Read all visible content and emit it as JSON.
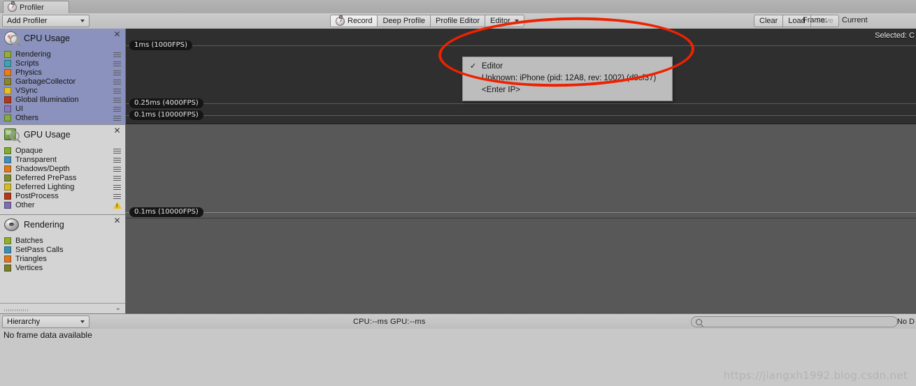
{
  "window": {
    "tab_label": "Profiler",
    "tab_icon": "stopwatch-icon"
  },
  "toolbar": {
    "add_profiler_label": "Add Profiler",
    "record_label": "Record",
    "deep_profile_label": "Deep Profile",
    "profile_editor_label": "Profile Editor",
    "target_label": "Editor",
    "clear_label": "Clear",
    "load_label": "Load",
    "save_label": "Save",
    "frame_label": "Frame:",
    "frame_value": "Current"
  },
  "target_menu": {
    "items": [
      {
        "label": "Editor",
        "checked": true
      },
      {
        "label": "Unknown: iPhone (pid: 12A8, rev: 1002) (d8cf37)",
        "checked": false
      },
      {
        "label": "<Enter IP>",
        "checked": false
      }
    ]
  },
  "modules": [
    {
      "title": "CPU Usage",
      "icon": "cpu-usage-icon",
      "selected": true,
      "close_icon": "close-icon",
      "legend": [
        {
          "label": "Rendering",
          "color": "#93ae30"
        },
        {
          "label": "Scripts",
          "color": "#3ba5b5"
        },
        {
          "label": "Physics",
          "color": "#e87e1a"
        },
        {
          "label": "GarbageCollector",
          "color": "#8b8728"
        },
        {
          "label": "VSync",
          "color": "#e3c223"
        },
        {
          "label": "Global Illumination",
          "color": "#b8361c"
        },
        {
          "label": "UI",
          "color": "#8a79b8"
        },
        {
          "label": "Others",
          "color": "#86ac3a"
        }
      ]
    },
    {
      "title": "GPU Usage",
      "icon": "gpu-usage-icon",
      "selected": false,
      "close_icon": "close-icon",
      "legend": [
        {
          "label": "Opaque",
          "color": "#7fad2e"
        },
        {
          "label": "Transparent",
          "color": "#3f8fc0"
        },
        {
          "label": "Shadows/Depth",
          "color": "#e07a1c"
        },
        {
          "label": "Deferred PrePass",
          "color": "#7f8c2c"
        },
        {
          "label": "Deferred Lighting",
          "color": "#d6bb26"
        },
        {
          "label": "PostProcess",
          "color": "#b23a18"
        },
        {
          "label": "Other",
          "color": "#7d6fb0",
          "warning": true
        }
      ]
    },
    {
      "title": "Rendering",
      "icon": "rendering-icon",
      "selected": false,
      "close_icon": "close-icon",
      "legend": [
        {
          "label": "Batches",
          "color": "#8fb02e"
        },
        {
          "label": "SetPass Calls",
          "color": "#3b8fba"
        },
        {
          "label": "Triangles",
          "color": "#e0781b"
        },
        {
          "label": "Vertices",
          "color": "#7c7f2a"
        }
      ]
    }
  ],
  "graphs": {
    "cpu": {
      "selected_text": "Selected: C",
      "gridlines": [
        {
          "label": "1ms (1000FPS)",
          "top_pct": 18
        },
        {
          "label": "0.25ms (4000FPS)",
          "top_pct": 79
        },
        {
          "label": "0.1ms (10000FPS)",
          "top_pct": 91
        }
      ]
    },
    "gpu": {
      "gridlines": [
        {
          "label": "0.1ms (10000FPS)",
          "top_pct": 94
        }
      ]
    },
    "rendering": {
      "gridlines": []
    }
  },
  "bottom": {
    "view_label": "Hierarchy",
    "cpu_time": "CPU:--ms",
    "gpu_time": "GPU:--ms",
    "search_placeholder": "",
    "search_value": "",
    "no_details_label": "No D",
    "no_frame_data": "No frame data available"
  },
  "watermark": "https://jiangxh1992.blog.csdn.net",
  "colors": {
    "accent_selected": "#8a92bd",
    "annotation": "#ee2200"
  }
}
